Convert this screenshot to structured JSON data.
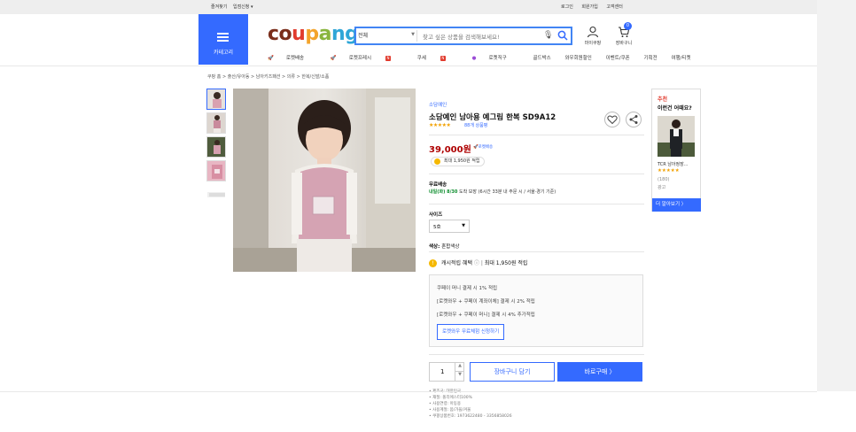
{
  "topbar": {
    "favorites": "즐겨찾기",
    "seller": "입점신청 ▾",
    "login": "로그인",
    "signup": "회원가입",
    "support": "고객센터"
  },
  "header": {
    "category_label": "카테고리",
    "logo": [
      "c",
      "o",
      "u",
      "p",
      "a",
      "n",
      "g"
    ],
    "search": {
      "scope": "전체",
      "placeholder": "찾고 싶은 상품을 검색해보세요!"
    },
    "mycoupang": "마이쿠팡",
    "cart": "장바구니",
    "cart_count": "0",
    "quicknav": [
      "로켓배송",
      "로켓프레시",
      "쿠세",
      "로켓직구",
      "골드박스",
      "와우회원할인",
      "이벤트/쿠폰",
      "기획전",
      "여행/티켓"
    ]
  },
  "breadcrumb": "쿠팡 홈  >  출산/유아동  >  남아키즈패션  >  의류  >  한복/신발/소품",
  "product": {
    "brand": "소담예인",
    "title": "소담예인 남아용 예그림 한복 SD9A12",
    "stars": "★★★★★",
    "reviews": "88개 상품평",
    "price": "39,000원",
    "rocket": "로켓배송",
    "points": "최대 1,950원 적립",
    "shipping_title": "무료배송",
    "shipping_date": "내일(화) 8/30",
    "shipping_arrive": "도착 보장",
    "shipping_note": "(6시간 33분 내 주문 시 / 서울·경기 기준)",
    "size_label": "사이즈",
    "size_value": "5호",
    "color_label": "색상:",
    "color_value": "혼합색상",
    "cash_title": "캐시적립 혜택",
    "cash_sep": "|",
    "cash_max": "최대 1,950원 적립",
    "cash_lines": [
      "쿠페이 머니 결제 시 1% 적립",
      "[로켓와우 + 쿠페이 계좌이체] 결제 시 2% 적립",
      "[로켓와우 + 쿠페이 머니] 결제 시 4% 추가적립"
    ],
    "wow_button": "로켓와우 무료체험 신청하기",
    "quantity": "1",
    "add_to_cart": "장바구니 담기",
    "buy_now": "바로구매 〉",
    "details": [
      "• 제조국: 대한민국",
      "• 재질: 폴리에스터100%",
      "• 사용연령: 아동용",
      "• 사용계절: 봄/가을/겨울",
      "• 쿠팡상품번호: 1973622480 - 3356858026"
    ]
  },
  "recommend": {
    "tag": "추천",
    "heading": "이런건 어때요?",
    "name": "TCR 남아정장...",
    "stars": "★★★★★",
    "count": "(180)",
    "ad": "광고",
    "more": "더 알아보기 〉"
  },
  "colors": {
    "accent": "#346aff",
    "price": "#ae0000",
    "star": "#f2a100"
  }
}
